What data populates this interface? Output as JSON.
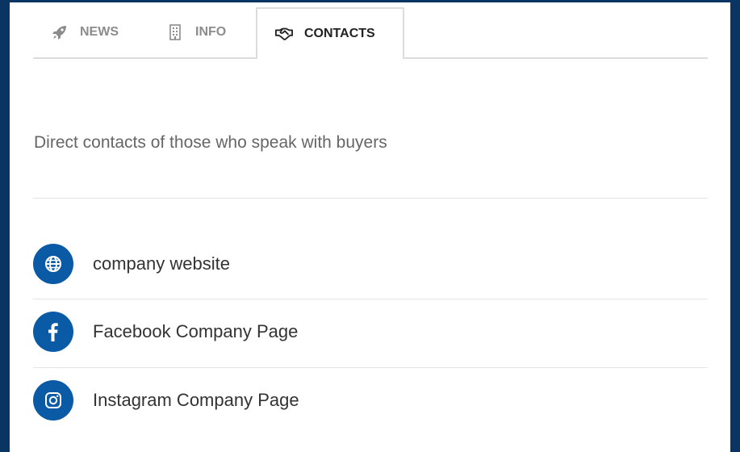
{
  "tabs": [
    {
      "label": "NEWS",
      "icon": "rocket-icon"
    },
    {
      "label": "INFO",
      "icon": "building-icon"
    },
    {
      "label": "CONTACTS",
      "icon": "handshake-icon",
      "active": true
    }
  ],
  "description": "Direct contacts of those who speak with buyers",
  "contacts": [
    {
      "label": "company website",
      "icon": "globe-icon"
    },
    {
      "label": "Facebook Company Page",
      "icon": "facebook-icon"
    },
    {
      "label": "Instagram Company Page",
      "icon": "instagram-icon"
    }
  ],
  "colors": {
    "background": "#0a3462",
    "accent": "#0b5aa6",
    "active_tab_text": "#222222",
    "inactive_tab_text": "#8c8c8c"
  }
}
